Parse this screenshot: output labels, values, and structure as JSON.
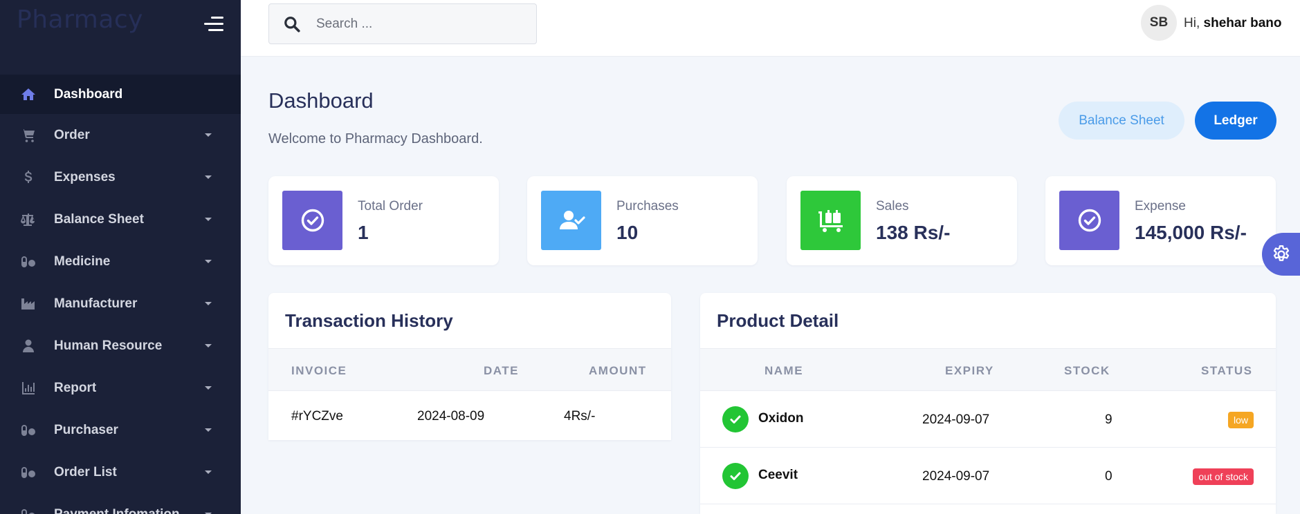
{
  "app": {
    "brand": "Pharmacy"
  },
  "sidebar": {
    "items": [
      {
        "label": "Dashboard",
        "icon": "home-icon",
        "active": true
      },
      {
        "label": "Order",
        "icon": "cart-icon"
      },
      {
        "label": "Expenses",
        "icon": "dollar-icon"
      },
      {
        "label": "Balance Sheet",
        "icon": "scale-icon"
      },
      {
        "label": "Medicine",
        "icon": "pills-icon"
      },
      {
        "label": "Manufacturer",
        "icon": "industry-icon"
      },
      {
        "label": "Human Resource",
        "icon": "user-icon"
      },
      {
        "label": "Report",
        "icon": "chart-icon"
      },
      {
        "label": "Purchaser",
        "icon": "pills-icon"
      },
      {
        "label": "Order List",
        "icon": "pills-icon"
      },
      {
        "label": "Payment Infomation",
        "icon": "pills-icon"
      }
    ]
  },
  "topbar": {
    "search_placeholder": "Search ...",
    "avatar_initials": "SB",
    "greeting_prefix": "Hi,",
    "user_name": "shehar bano"
  },
  "header": {
    "title": "Dashboard",
    "subtitle": "Welcome to Pharmacy Dashboard.",
    "balance_sheet_button": "Balance Sheet",
    "ledger_button": "Ledger"
  },
  "stats": [
    {
      "label": "Total Order",
      "value": "1",
      "icon": "check-circle-icon",
      "color": "#6a5fd1"
    },
    {
      "label": "Purchases",
      "value": "10",
      "icon": "user-check-icon",
      "color": "#4eaaf5"
    },
    {
      "label": "Sales",
      "value": "138 Rs/-",
      "icon": "luggage-cart-icon",
      "color": "#2ec83a"
    },
    {
      "label": "Expense",
      "value": "145,000 Rs/-",
      "icon": "check-circle-icon",
      "color": "#6a5fd1"
    }
  ],
  "transactions": {
    "title": "Transaction History",
    "columns": [
      "Invoice",
      "Date",
      "Amount"
    ],
    "rows": [
      {
        "invoice": "#rYCZve",
        "date": "2024-08-09",
        "amount": "4Rs/-"
      }
    ]
  },
  "products": {
    "title": "Product Detail",
    "columns": [
      "Name",
      "Expiry",
      "Stock",
      "Status"
    ],
    "rows": [
      {
        "name": "Oxidon",
        "expiry": "2024-09-07",
        "stock": "9",
        "status": "low"
      },
      {
        "name": "Ceevit",
        "expiry": "2024-09-07",
        "stock": "0",
        "status": "out of stock"
      }
    ]
  },
  "colors": {
    "sidebar_bg": "#1b2138",
    "accent": "#1373e6",
    "status_low": "#f5a623",
    "status_out": "#ef4058",
    "check_green": "#22c534"
  }
}
